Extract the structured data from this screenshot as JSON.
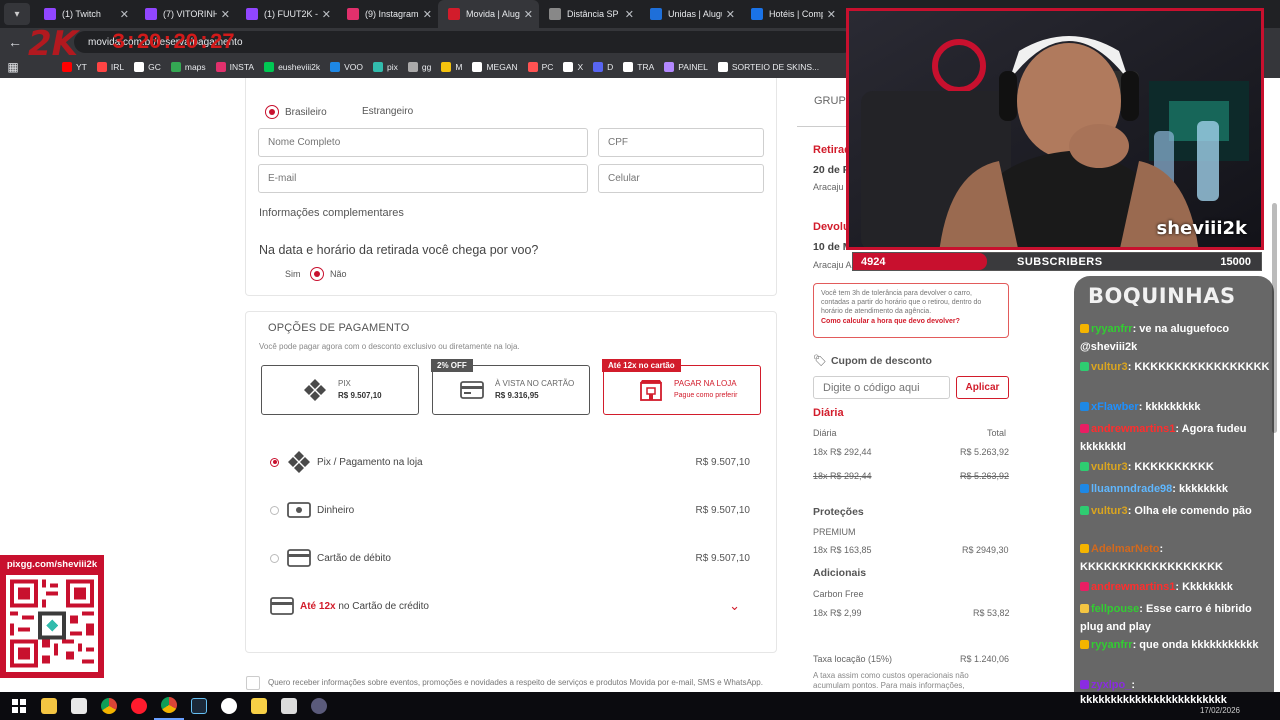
{
  "browser": {
    "tabs": [
      {
        "label": "(1) Twitch",
        "color": "#9146ff"
      },
      {
        "label": "(7) VITORINHA",
        "color": "#9146ff"
      },
      {
        "label": "(1) FUUT2K - T",
        "color": "#9146ff"
      },
      {
        "label": "(9) Instagram",
        "color": "#e1306c"
      },
      {
        "label": "Movida | Alugu",
        "color": "#d21c2b",
        "active": true
      },
      {
        "label": "Distância SP F",
        "color": "#888888"
      },
      {
        "label": "Unidas | Alugu",
        "color": "#1e6fd9"
      },
      {
        "label": "Hotéis | Comp",
        "color": "#1a73e8"
      }
    ],
    "address": "movida.com.br/reserva/pagamento",
    "bookmarks": [
      {
        "label": "YT",
        "color": "#ff0000"
      },
      {
        "label": "IRL",
        "color": "#ff4444"
      },
      {
        "label": "GC",
        "color": "#ffffff"
      },
      {
        "label": "maps",
        "color": "#34a853"
      },
      {
        "label": "INSTA",
        "color": "#e1306c"
      },
      {
        "label": "eusheviii2k",
        "color": "#00c853"
      },
      {
        "label": "VOO",
        "color": "#1e88e5"
      },
      {
        "label": "pix",
        "color": "#32bcad"
      },
      {
        "label": "gg",
        "color": "#aaaaaa"
      },
      {
        "label": "M",
        "color": "#f4c20d"
      },
      {
        "label": "MEGAN",
        "color": "#ffffff"
      },
      {
        "label": "PC",
        "color": "#ff5252"
      },
      {
        "label": "X",
        "color": "#ffffff"
      },
      {
        "label": "D",
        "color": "#5865f2"
      },
      {
        "label": "TRA",
        "color": "#ffffff"
      },
      {
        "label": "PAINEL",
        "color": "#b388ff"
      },
      {
        "label": "SORTEIO DE SKINS...",
        "color": "#ffffff"
      }
    ]
  },
  "overlay": {
    "logo": "2K",
    "timer": "3:20:20:27"
  },
  "form": {
    "nationality": {
      "brasileiro": "Brasileiro",
      "estrangeiro": "Estrangeiro"
    },
    "placeholders": {
      "nome": "Nome Completo",
      "cpf": "CPF",
      "email": "E-mail",
      "celular": "Celular"
    },
    "info_complementares": "Informações complementares",
    "flight_question": "Na data e horário da retirada você chega por voo?",
    "sim": "Sim",
    "nao": "Não"
  },
  "payment": {
    "title": "OPÇÕES DE PAGAMENTO",
    "subtitle": "Você pode pagar agora com o desconto exclusivo ou diretamente na loja.",
    "options": [
      {
        "line1": "PIX",
        "line2": "R$ 9.507,10",
        "ribbon": "",
        "selected": false
      },
      {
        "line1": "À VISTA NO CARTÃO",
        "line2": "R$ 9.316,95",
        "ribbon": "2% OFF",
        "selected": false
      },
      {
        "line1": "PAGAR NA LOJA",
        "line2": "Pague como preferir",
        "ribbon": "Até 12x no cartão",
        "selected": true
      }
    ],
    "methods": [
      {
        "label": "Pix / Pagamento na loja",
        "price": "R$ 9.507,10",
        "selected": true
      },
      {
        "label": "Dinheiro",
        "price": "R$ 9.507,10",
        "selected": false
      },
      {
        "label": "Cartão de débito",
        "price": "R$ 9.507,10",
        "selected": false
      }
    ],
    "credit_prefix": "Até 12x",
    "credit_suffix": " no Cartão de crédito",
    "newsletter": "Quero receber informações sobre eventos, promoções e novidades a respeito de serviços e produtos Movida por e-mail, SMS e WhatsApp."
  },
  "summary": {
    "group": "GRUPO",
    "retirada_title": "Retirada",
    "retirada_date": "20 de Fe",
    "retirada_place": "Aracaju",
    "devolucao_title": "Devolu",
    "devolucao_date": "10 de M",
    "devolucao_place": "Aracaju A",
    "tolerance_text": "Você tem 3h de tolerância para devolver o carro, contadas a partir do horário que o retirou, dentro do horário de atendimento da agência.",
    "tolerance_link": "Como calcular a hora que devo devolver?",
    "cupom_title": "Cupom de desconto",
    "cupom_placeholder": "Digite o código aqui",
    "cupom_button": "Aplicar",
    "diaria_title": "Diária",
    "col_diaria": "Diária",
    "col_total": "Total",
    "diaria_rows": [
      {
        "left": "18x R$ 292,44",
        "right": "R$ 5.263,92",
        "struck": false
      },
      {
        "left": "18x R$ 292,44",
        "right": "R$ 5.263,92",
        "struck": true
      }
    ],
    "protecoes_title": "Proteções",
    "protecao_name": "PREMIUM",
    "protecao_left": "18x R$ 163,85",
    "protecao_right": "R$ 2949,30",
    "adicionais_title": "Adicionais",
    "adicional_name": "Carbon Free",
    "adicional_left": "18x R$ 2,99",
    "adicional_right": "R$ 53,82",
    "taxa_label": "Taxa locação (15%)",
    "taxa_value": "R$ 1.240,06",
    "taxa_note": "A taxa assim como custos operacionais não acumulam pontos. Para mais informações,"
  },
  "stream": {
    "webcam_name": "sheviii2k",
    "subs_current": "4924",
    "subs_label": "SUBSCRIBERS",
    "subs_goal": "15000",
    "subs_progress": 0.3283,
    "qr_url": "pixgg.com/sheviii2k",
    "chat_title": "BOQUINHAS",
    "messages": [
      {
        "user": "ryyanfrr",
        "color": "#32cd32",
        "text": ": ve na aluguefoco @sheviii2k"
      },
      {
        "user": "vultur3",
        "color": "#daa520",
        "text": ": KKKKKKKKKKKKKKKKK"
      },
      {
        "user": "xFlawber",
        "color": "#1e90ff",
        "text": ": kkkkkkkkk"
      },
      {
        "user": "andrewmartins1",
        "color": "#ff2d2d",
        "text": ": Agora fudeu kkkkkkkl"
      },
      {
        "user": "vultur3",
        "color": "#daa520",
        "text": ": KKKKKKKKKK"
      },
      {
        "user": "lluannndrade98",
        "color": "#5fb7ff",
        "text": ": kkkkkkkk"
      },
      {
        "user": "vultur3",
        "color": "#daa520",
        "text": ": Olha ele comendo pão"
      },
      {
        "user": "AdelmarNeto",
        "color": "#d2691e",
        "text": ": KKKKKKKKKKKKKKKKKK"
      },
      {
        "user": "andrewmartins1",
        "color": "#ff2d2d",
        "text": ": Kkkkkkkk"
      },
      {
        "user": "fellpouse",
        "color": "#32cd32",
        "text": ": Esse carro é hibrido plug and play"
      },
      {
        "user": "ryyanfrr",
        "color": "#32cd32",
        "text": ": que onda kkkkkkkkkkk"
      },
      {
        "user": "zyxlpo_",
        "color": "#8a2be2",
        "text": ":"
      }
    ],
    "last_line": "kkkkkkkkkkkkkkkkkkkkkkkk",
    "tray_date": "17/02/2026"
  }
}
